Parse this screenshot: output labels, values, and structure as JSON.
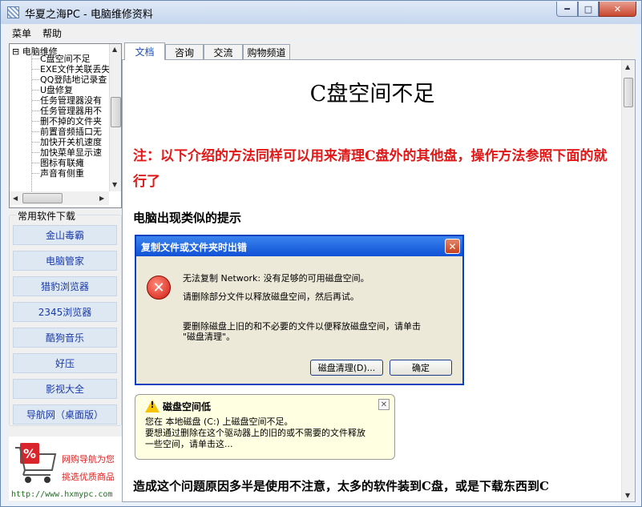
{
  "window": {
    "title": "华夏之海PC - 电脑维修资料"
  },
  "menu": [
    "菜单",
    "帮助"
  ],
  "tree": {
    "root": "电脑维修",
    "items": [
      "C盘空间不足",
      "EXE文件关联丢失",
      "QQ登陆地记录查",
      "U盘修复",
      "任务管理器没有",
      "任务管理器用不",
      "删不掉的文件夹",
      "前置音频插口无",
      "加快开关机速度",
      "加快菜单显示速",
      "图标有联瘫",
      "声音有侧重"
    ]
  },
  "software": {
    "title": "常用软件下载",
    "items": [
      "金山毒霸",
      "电脑管家",
      "猎豹浏览器",
      "2345浏览器",
      "酷狗音乐",
      "好压",
      "影视大全",
      "导航网（桌面版）"
    ]
  },
  "ad": {
    "line1": "网购导航为您",
    "line2": "挑选优质商品",
    "url": "http://www.hxmypc.com"
  },
  "tabs": [
    "文档",
    "咨询",
    "交流",
    "购物频道"
  ],
  "doc": {
    "title": "C盘空间不足",
    "note": "注：以下介绍的方法同样可以用来清理C盘外的其他盘，操作方法参照下面的就行了",
    "subtitle": "电脑出现类似的提示",
    "bottom": "造成这个问题原因多半是使用不注意，太多的软件装到C盘，或是下载东西到C"
  },
  "error_dialog": {
    "title": "复制文件或文件夹时出错",
    "msg1": "无法复制 Network: 没有足够的可用磁盘空间。",
    "msg2": "请删除部分文件以释放磁盘空间，然后再试。",
    "msg3": "要删除磁盘上旧的和不必要的文件以便释放磁盘空间，请单击",
    "msg4": "\"磁盘清理\"。",
    "btn_cleanup": "磁盘清理(D)...",
    "btn_ok": "确定"
  },
  "balloon": {
    "title": "磁盘空间低",
    "line1": "您在 本地磁盘 (C:) 上磁盘空间不足。",
    "line2": "要想通过删除在这个驱动器上的旧的或不需要的文件释放",
    "line3": "一些空间，请单击这..."
  }
}
